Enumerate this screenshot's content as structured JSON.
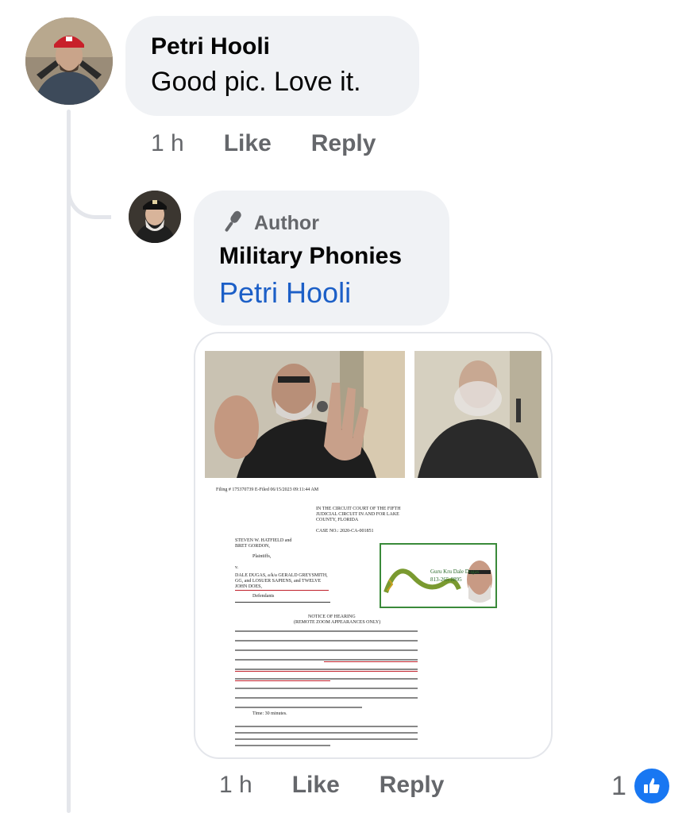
{
  "comment1": {
    "author": "Petri Hooli",
    "text": "Good pic. Love it.",
    "time": "1 h",
    "like_label": "Like",
    "reply_label": "Reply"
  },
  "comment2": {
    "badge_icon": "microphone-icon",
    "badge_label": "Author",
    "author": "Military Phonies",
    "mention": "Petri Hooli",
    "time": "1 h",
    "like_label": "Like",
    "reply_label": "Reply",
    "reaction_count": "1"
  },
  "attachment": {
    "filing_header": "Filing # 175370739 E-Filed 06/15/2023 09:11:44 AM",
    "court": "IN THE CIRCUIT COURT OF THE FIFTH JUDICIAL CIRCUIT IN AND FOR LAKE COUNTY, FLORIDA",
    "case_no": "CASE NO.: 2020-CA-001851",
    "plaintiffs": "STEVEN W. HATFIELD and BRET GORDON,",
    "plaintiffs_label": "Plaintiffs,",
    "v": "v.",
    "defendants_text": "DALE DUGAS, a/k/a GERALD GREYSMITH, GG, and LOSUER SAPIENS, and TWELVE JOHN DOES,",
    "defendants_label": "Defendants",
    "notice_title": "NOTICE OF HEARING",
    "notice_sub": "(REMOTE ZOOM APPEARANCES ONLY)",
    "card_name": "Guru Kru Dale Dugas",
    "card_phone": "813-265-8895",
    "time_line": "Time: 30 minutes."
  },
  "colors": {
    "bubble": "#f0f2f5",
    "meta_gray": "#65676b",
    "mention_blue": "#1c5fc7",
    "like_blue": "#1877f2",
    "thread_line": "#e4e6eb"
  }
}
